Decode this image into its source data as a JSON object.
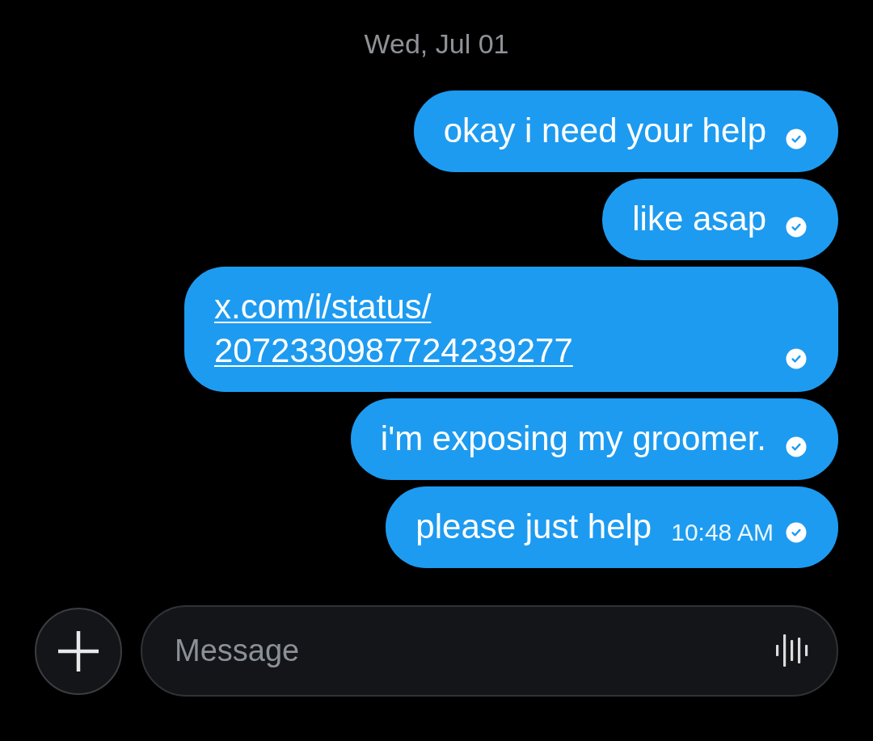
{
  "date_divider": {
    "label": "Wed, Jul 01"
  },
  "messages": [
    {
      "kind": "text",
      "text": "okay i need your help",
      "sent": true
    },
    {
      "kind": "text",
      "text": "like asap",
      "sent": true
    },
    {
      "kind": "link",
      "text": "x.com/i/status/2072330987724239277",
      "sent": true
    },
    {
      "kind": "text",
      "text": "i'm exposing my groomer.",
      "sent": true
    },
    {
      "kind": "text",
      "text": "please just help",
      "time": "10:48 AM",
      "sent": true
    }
  ],
  "composer": {
    "placeholder": "Message"
  }
}
